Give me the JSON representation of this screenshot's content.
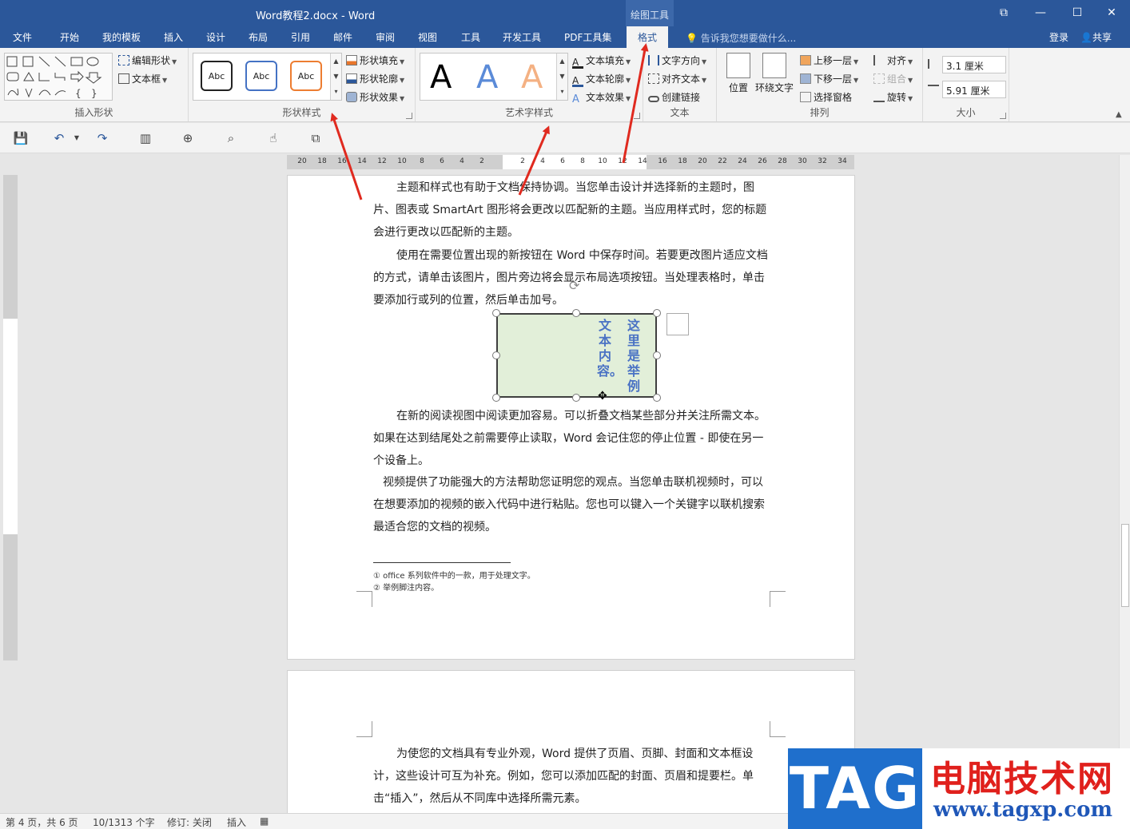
{
  "window": {
    "title": "Word教程2.docx - Word",
    "context_tab_group": "绘图工具",
    "buttons": [
      "⧉",
      "—",
      "☐",
      "✕"
    ]
  },
  "tabs": [
    "文件",
    "开始",
    "我的模板",
    "插入",
    "设计",
    "布局",
    "引用",
    "邮件",
    "审阅",
    "视图",
    "工具",
    "开发工具",
    "PDF工具集",
    "格式"
  ],
  "active_tab": "格式",
  "tellme": "告诉我您想要做什么...",
  "login": "登录",
  "share": "共享",
  "ribbon": {
    "insert_shapes": {
      "label": "插入形状",
      "edit_shape": "编辑形状",
      "text_box": "文本框"
    },
    "shape_styles": {
      "label": "形状样式",
      "sample": "Abc",
      "fill": "形状填充",
      "outline": "形状轮廓",
      "effects": "形状效果"
    },
    "wordart_styles": {
      "label": "艺术字样式",
      "sample": "A",
      "text_fill": "文本填充",
      "text_outline": "文本轮廓",
      "text_effects": "文本效果"
    },
    "text": {
      "label": "文本",
      "direction": "文字方向",
      "align": "对齐文本",
      "link": "创建链接"
    },
    "arrange": {
      "label": "排列",
      "position": "位置",
      "wrap": "环绕文字",
      "forward": "上移一层",
      "backward": "下移一层",
      "pane": "选择窗格",
      "align": "对齐",
      "group": "组合",
      "rotate": "旋转"
    },
    "size": {
      "label": "大小",
      "height": "3.1 厘米",
      "width": "5.91 厘米"
    }
  },
  "ruler": {
    "h_ticks": [
      "20",
      "18",
      "16",
      "14",
      "12",
      "10",
      "8",
      "6",
      "4",
      "2",
      "2",
      "4",
      "6",
      "8",
      "10",
      "12",
      "14",
      "16",
      "18",
      "20",
      "22",
      "24",
      "26",
      "28",
      "30",
      "32",
      "34"
    ]
  },
  "document": {
    "p1": "主题和样式也有助于文档保持协调。当您单击设计并选择新的主题时，图片、图表或 SmartArt 图形将会更改以匹配新的主题。当应用样式时，您的标题会进行更改以匹配新的主题。",
    "p2": "使用在需要位置出现的新按钮在 Word 中保存时间。若要更改图片适应文档的方式，请单击该图片，图片旁边将会显示布局选项按钮。当处理表格时，单击要添加行或列的位置，然后单击加号。",
    "textbox_col1": "这里是举例",
    "textbox_col2": "文本内容。",
    "p3": "在新的阅读视图中阅读更加容易。可以折叠文档某些部分并关注所需文本。如果在达到结尾处之前需要停止读取，Word 会记住您的停止位置 - 即使在另一个设备上。",
    "p4": "视频提供了功能强大的方法帮助您证明您的观点。当您单击联机视频时，可以在想要添加的视频的嵌入代码中进行粘贴。您也可以键入一个关键字以联机搜索最适合您的文档的视频。",
    "fn1": "① office 系列软件中的一款，用于处理文字。",
    "fn2": "② 举例脚注内容。",
    "p5": "为使您的文档具有专业外观，Word 提供了页眉、页脚、封面和文本框设计，这些设计可互为补充。例如，您可以添加匹配的封面、页眉和提要栏。单击“插入”，然后从不同库中选择所需元素。"
  },
  "status": {
    "page": "第 4 页，共 6 页",
    "words": "10/1313 个字",
    "track": "修订: 关闭",
    "insert": "插入"
  },
  "watermark": {
    "tag": "TAG",
    "cn": "电脑技术网",
    "url": "www.tagxp.com"
  },
  "colors": {
    "brand": "#2b579a",
    "arrow": "#e02a1f",
    "textbox_fill": "#e2efd9",
    "textbox_text": "#4a72c4"
  }
}
